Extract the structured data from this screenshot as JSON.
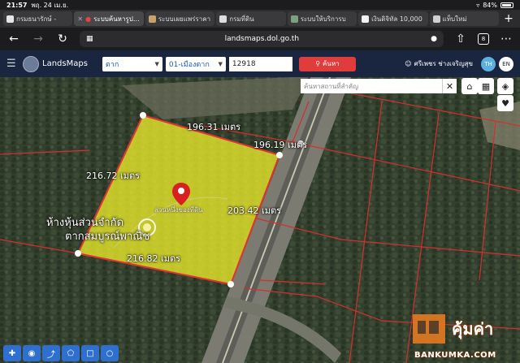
{
  "status": {
    "time": "21:57",
    "date": "พฤ. 24 เม.ย.",
    "battery": "84%"
  },
  "tabs": [
    {
      "title": "กรมธนารักษ์ -",
      "fav_color": "#e6e6e6",
      "active": false
    },
    {
      "title": "ระบบค้นหารูปแปลง",
      "fav_color": "#e8433b",
      "active": true
    },
    {
      "title": "ระบบเผยแพร่ราคา",
      "fav_color": "#c9a26a",
      "active": false
    },
    {
      "title": "กรมที่ดิน",
      "fav_color": "#dddddd",
      "active": false
    },
    {
      "title": "ระบบให้บริการบ",
      "fav_color": "#7fa07f",
      "active": false
    },
    {
      "title": "เงินดิจิทัล 10,000",
      "fav_color": "#f2f2f2",
      "active": false
    },
    {
      "title": "แท็บใหม่",
      "fav_color": "#d0d0d0",
      "active": false
    }
  ],
  "browser": {
    "url": "landsmaps.dol.go.th",
    "tab_count": "8"
  },
  "app": {
    "name": "LandsMaps",
    "province": "ตาก",
    "district": "01-เมืองตาก",
    "parcel_no": "12918",
    "search_label": "ค้นหา",
    "user": "ศรีเพชร ช่างเจริญสุข",
    "lang_th": "TH",
    "lang_en": "EN"
  },
  "map": {
    "place_search_placeholder": "ค้นหาสถานที่สำคัญ",
    "parcel_fill": "#ecec2a",
    "parcel_border": "#e23434",
    "measurements": {
      "top_left": "196.31 เมตร",
      "top_right": "196.19 เมตร",
      "left": "216.72 เมตร",
      "right": "203.42 เมตร",
      "bottom": "216.82 เมตร"
    },
    "owner_label_line1": "ห้างหุ้นส่วนจำกัด",
    "owner_label_line2": "ตากสมบูรณ์พาณิช",
    "parcel_text": "ส่วนหนึ่งของที่ดิน"
  },
  "watermark": {
    "thai": "คุ้มค่า",
    "english": "BANKUMKA.COM"
  }
}
